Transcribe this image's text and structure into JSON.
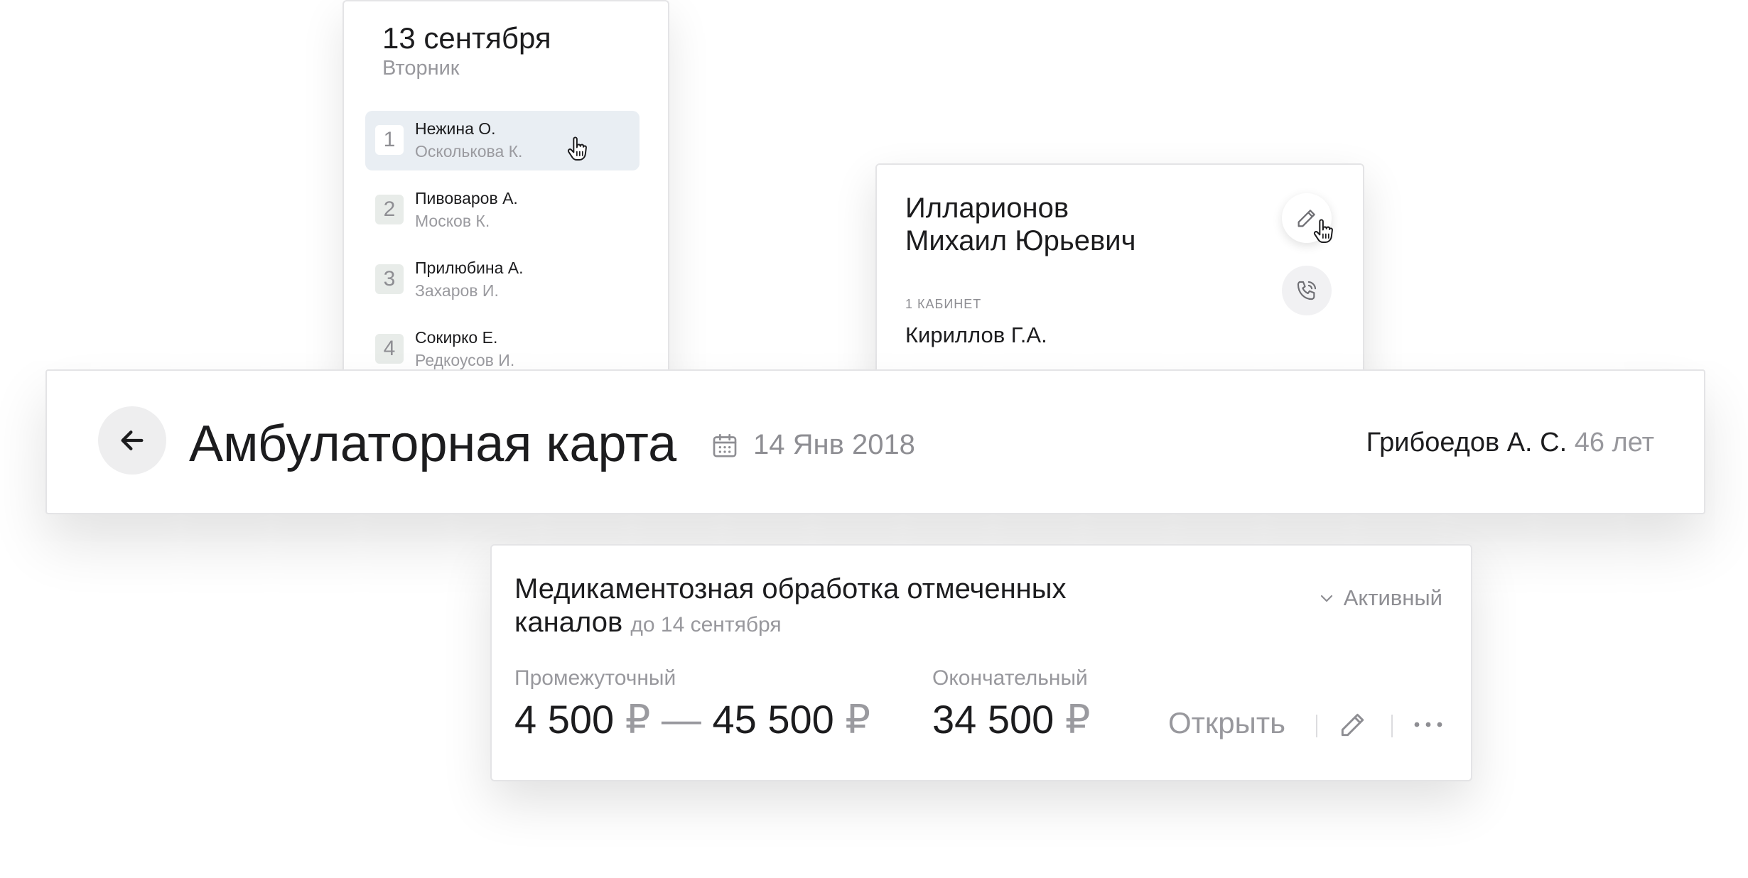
{
  "schedule": {
    "date": "13 сентября",
    "weekday": "Вторник",
    "items": [
      {
        "num": "1",
        "patient": "Нежина О.",
        "doctor": "Осколькова К."
      },
      {
        "num": "2",
        "patient": "Пивоваров А.",
        "doctor": "Москов К."
      },
      {
        "num": "3",
        "patient": "Прилюбина А.",
        "doctor": "Захаров И."
      },
      {
        "num": "4",
        "patient": "Сокирко Е.",
        "doctor": "Редкоусов И."
      }
    ]
  },
  "doctor_card": {
    "name_line1": "Илларионов",
    "name_line2": "Михаил Юрьевич",
    "room_label": "1 КАБИНЕТ",
    "room_doctor": "Кириллов Г.А."
  },
  "header": {
    "title": "Амбулаторная карта",
    "date": "14 Янв 2018",
    "patient_name": "Грибоедов А. С.",
    "patient_age": "46 лет"
  },
  "treatment": {
    "title": "Медикаментозная обработка отмеченных каналов",
    "due": "до 14 сентября",
    "status": "Активный",
    "intermediate_label": "Промежуточный",
    "intermediate_from": "4 500",
    "intermediate_to": "45 500",
    "currency": "₽",
    "dash": "—",
    "final_label": "Окончательный",
    "final_value": "34 500",
    "open_label": "Открыть"
  },
  "icons": {
    "back": "arrow-left-icon",
    "calendar": "calendar-icon",
    "edit": "pencil-icon",
    "call": "phone-icon",
    "status": "chevron-down-icon",
    "more": "more-horizontal-icon",
    "cursor": "hand-pointer-icon"
  }
}
